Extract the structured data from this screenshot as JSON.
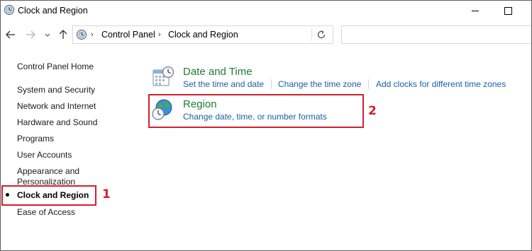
{
  "window": {
    "title": "Clock and Region"
  },
  "nav": {
    "breadcrumb": [
      "Control Panel",
      "Clock and Region"
    ],
    "search_placeholder": ""
  },
  "sidebar": {
    "items": [
      {
        "label": "Control Panel Home",
        "active": false
      },
      {
        "label": "System and Security",
        "active": false
      },
      {
        "label": "Network and Internet",
        "active": false
      },
      {
        "label": "Hardware and Sound",
        "active": false
      },
      {
        "label": "Programs",
        "active": false
      },
      {
        "label": "User Accounts",
        "active": false
      },
      {
        "label": "Appearance and",
        "active": false
      },
      {
        "label": "Personalization",
        "active": false
      },
      {
        "label": "Clock and Region",
        "active": true
      },
      {
        "label": "Ease of Access",
        "active": false
      }
    ]
  },
  "categories": [
    {
      "title": "Date and Time",
      "icon": "date-time-icon",
      "links": [
        "Set the time and date",
        "Change the time zone",
        "Add clocks for different time zones"
      ]
    },
    {
      "title": "Region",
      "icon": "region-globe-icon",
      "links": [
        "Change date, time, or number formats"
      ]
    }
  ],
  "annotations": {
    "step1": "1",
    "step2": "2",
    "color": "#d2202f"
  },
  "colors": {
    "category_title": "#1e7b34",
    "link": "#1a5faa"
  }
}
